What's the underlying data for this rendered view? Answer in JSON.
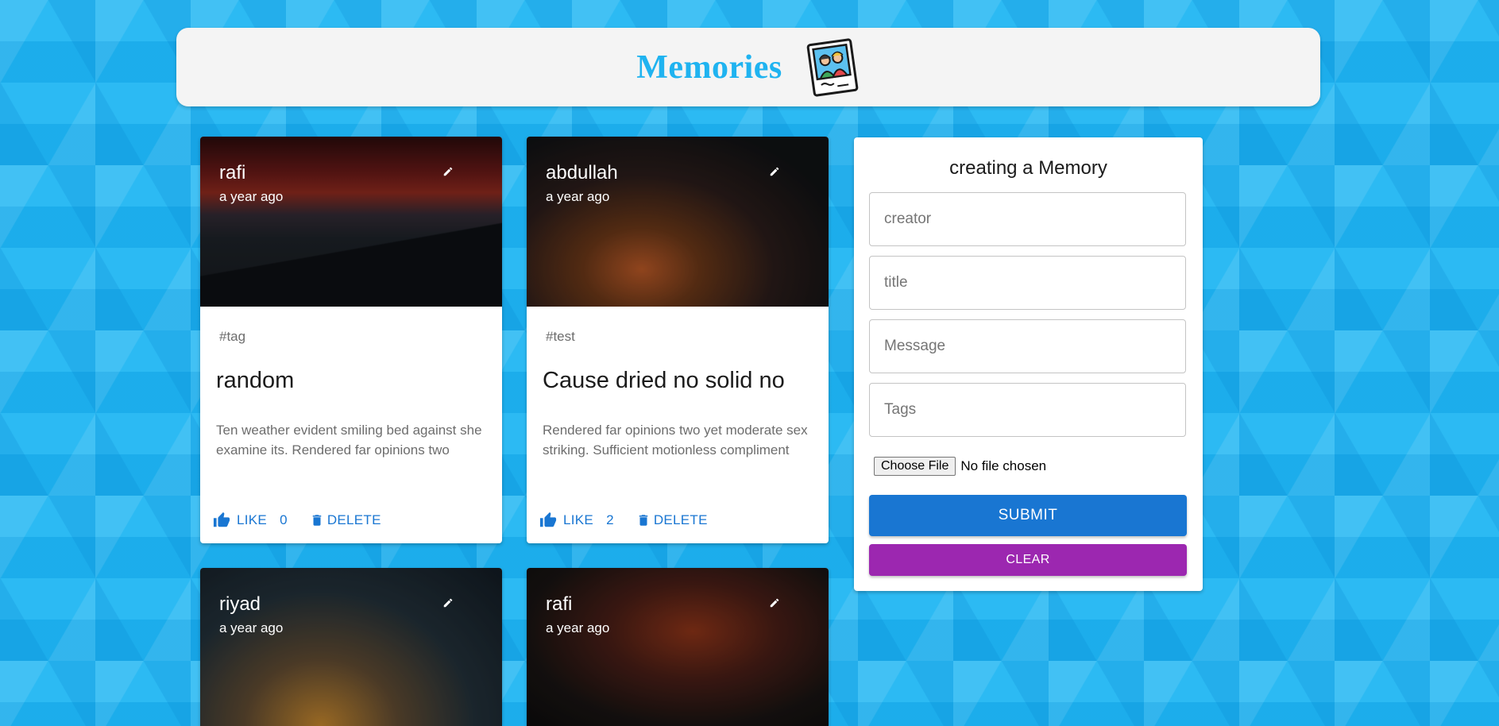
{
  "header": {
    "title": "Memories",
    "logo_icon": "memories-photo-logo-icon"
  },
  "posts": [
    {
      "creator": "rafi",
      "time": "a year ago",
      "tags": "#tag",
      "title": "random",
      "message": "Ten weather evident smiling bed against she examine its. Rendered far opinions two",
      "like_label": "LIKE",
      "like_count": "0",
      "delete_label": "DELETE"
    },
    {
      "creator": "abdullah",
      "time": "a year ago",
      "tags": "#test",
      "title": "Cause dried no solid no",
      "message": "Rendered far opinions two yet moderate sex striking. Sufficient motionless compliment",
      "like_label": "LIKE",
      "like_count": "2",
      "delete_label": "DELETE"
    },
    {
      "creator": "riyad",
      "time": "a year ago"
    },
    {
      "creator": "rafi",
      "time": "a year ago"
    }
  ],
  "form": {
    "title": "creating a Memory",
    "creator_placeholder": "creator",
    "title_placeholder": "title",
    "message_placeholder": "Message",
    "tags_placeholder": "Tags",
    "file_button": "Choose File",
    "file_status": "No file chosen",
    "submit_label": "SUBMIT",
    "clear_label": "CLEAR"
  },
  "colors": {
    "background": "#1fb6f2",
    "title": "#1fb3f0",
    "primary": "#1976d2",
    "secondary": "#9c27b0"
  }
}
